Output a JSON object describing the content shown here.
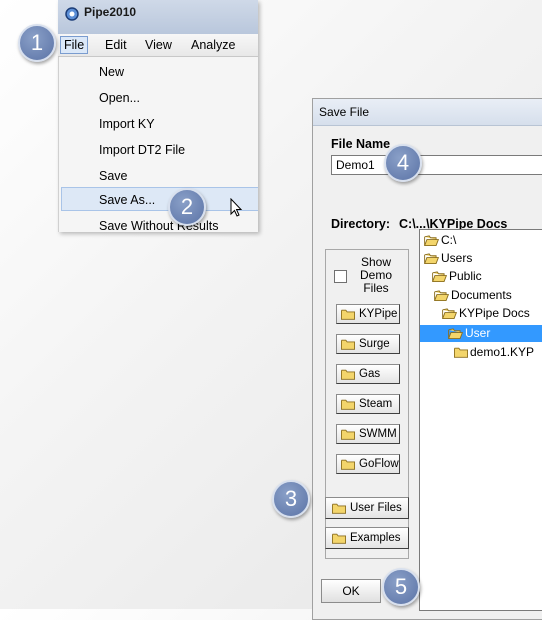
{
  "app": {
    "title": "Pipe2010"
  },
  "menubar": {
    "file": "File",
    "edit": "Edit",
    "view": "View",
    "analyze": "Analyze"
  },
  "file_menu": {
    "items": [
      "New",
      "Open...",
      "Import KY",
      "Import DT2 File",
      "Save",
      "Save As...",
      "Save Without Results"
    ],
    "highlighted": "Save As..."
  },
  "dialog": {
    "title": "Save File",
    "filename_label": "File Name",
    "filename_value": "Demo1",
    "directory_label": "Directory:",
    "directory_value": "C:\\...\\KYPipe Docs",
    "show_demo_label": "Show Demo Files",
    "folder_buttons": [
      "KYPipe",
      "Surge",
      "Gas",
      "Steam",
      "SWMM",
      "GoFlow"
    ],
    "user_files_button": "User Files",
    "examples_button": "Examples",
    "ok_button": "OK",
    "tree": [
      "C:\\",
      "Users",
      "Public",
      "Documents",
      "KYPipe Docs",
      "User",
      "demo1.KYP"
    ],
    "selected_tree_item": "User"
  },
  "steps": [
    "1",
    "2",
    "3",
    "4",
    "5"
  ],
  "colors": {
    "accent": "#3399ff",
    "callout": "#5b73a6",
    "folder": "#f3d56b"
  }
}
